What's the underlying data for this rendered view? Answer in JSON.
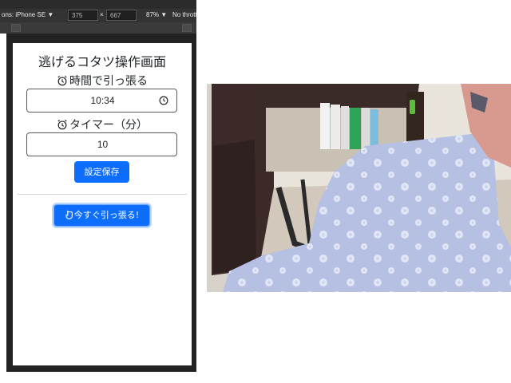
{
  "devtools": {
    "device": "ons: iPhone SE ▼",
    "width": "375",
    "times": "×",
    "height": "667",
    "zoom": "87% ▼",
    "throttle": "No thrott"
  },
  "app": {
    "title": "逃げるコタツ操作画面",
    "time_label": "時間で引っ張る",
    "time_value": "10:34",
    "timer_label": "タイマー（分）",
    "timer_value": "10",
    "save_button": "設定保存",
    "pull_button": "今すぐ引っ張る!"
  },
  "colors": {
    "primary": "#0d6efd",
    "blanket": "#b6c0e3",
    "cabinet": "#3b2a28"
  },
  "icons": [
    "alarm-clock-icon",
    "clock-icon",
    "hand-pointer-icon"
  ]
}
